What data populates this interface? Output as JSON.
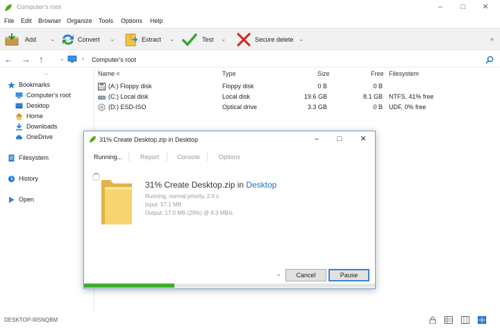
{
  "window": {
    "title": "Computer's root"
  },
  "menu": [
    "File",
    "Edit",
    "Browser",
    "Organize",
    "Tools",
    "Options",
    "Help"
  ],
  "toolbar": {
    "add": "Add",
    "convert": "Convert",
    "extract": "Extract",
    "test": "Test",
    "secure_delete": "Secure delete"
  },
  "address": {
    "path": "Computer's root"
  },
  "sidebar": {
    "dots": "...",
    "bookmarks": "Bookmarks",
    "bookmark_items": [
      "Computer's root",
      "Desktop",
      "Home",
      "Downloads",
      "OneDrive"
    ],
    "filesystem": "Filesystem",
    "history": "History",
    "open": "Open"
  },
  "filelist": {
    "headers": {
      "name": "Name <",
      "type": "Type",
      "size": "Size",
      "free": "Free",
      "filesystem": "Filesystem"
    },
    "rows": [
      {
        "name": "(A:) Floppy disk",
        "type": "Floppy disk",
        "size": "0 B",
        "free": "0 B",
        "filesystem": "",
        "icon": "floppy-icon"
      },
      {
        "name": "(C:) Local disk",
        "type": "Local disk",
        "size": "19.6 GB",
        "free": "8.1 GB",
        "filesystem": "NTFS, 41% free",
        "icon": "disk-icon"
      },
      {
        "name": "(D:) ESD-ISO",
        "type": "Optical drive",
        "size": "3.3 GB",
        "free": "0 B",
        "filesystem": "UDF, 0% free",
        "icon": "optical-icon"
      }
    ]
  },
  "status": {
    "host": "DESKTOP-IR5NQBM"
  },
  "dialog": {
    "title": "31% Create Desktop.zip in Desktop",
    "tabs": [
      "Running...",
      "Report",
      "Console",
      "Options"
    ],
    "headline_prefix": "31% Create Desktop.zip in ",
    "headline_link": "Desktop",
    "status_line": "Running, normal priority, 2.0 s",
    "input_line": "Input: 57.1 MB",
    "output_line": "Output: 17.0 MB (29%) @ 8.3 MB/s",
    "cancel": "Cancel",
    "pause": "Pause",
    "progress": 0.31,
    "progress_color": "#3dae2b"
  },
  "colors": {
    "accent": "#1b6fc7",
    "folder": "#f5cf6a"
  }
}
